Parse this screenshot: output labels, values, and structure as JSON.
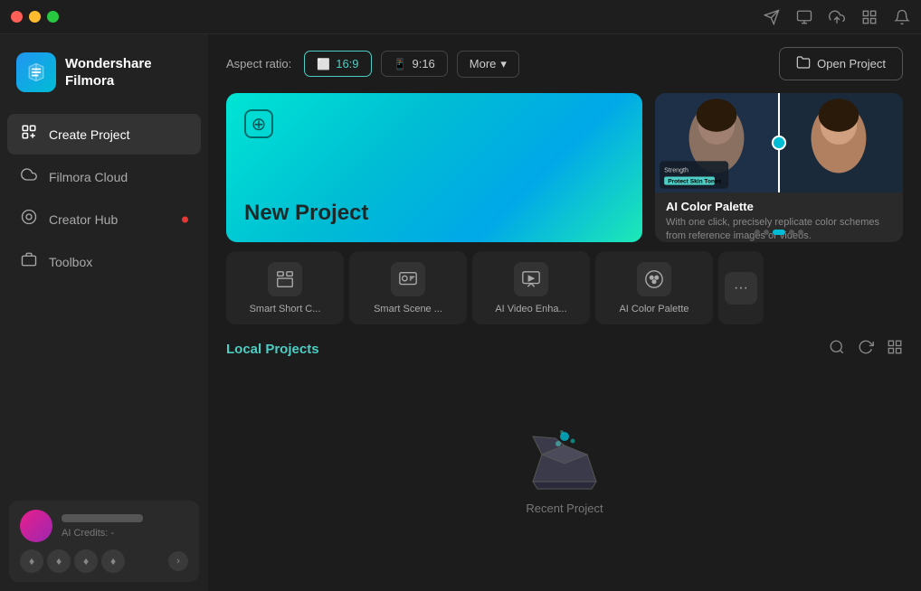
{
  "titlebar": {
    "app_name": "Wondershare Filmora"
  },
  "window_controls": {
    "close": "close",
    "minimize": "minimize",
    "maximize": "maximize"
  },
  "sidebar": {
    "logo_text": "Wondershare\nFilmora",
    "nav_items": [
      {
        "id": "create-project",
        "label": "Create Project",
        "icon": "⊞",
        "active": true,
        "dot": false
      },
      {
        "id": "filmora-cloud",
        "label": "Filmora Cloud",
        "icon": "☁",
        "active": false,
        "dot": false
      },
      {
        "id": "creator-hub",
        "label": "Creator Hub",
        "icon": "◎",
        "active": false,
        "dot": true
      },
      {
        "id": "toolbox",
        "label": "Toolbox",
        "icon": "⊡",
        "active": false,
        "dot": false
      }
    ],
    "user": {
      "name_placeholder": "",
      "credits_label": "AI Credits: -"
    }
  },
  "topbar": {
    "aspect_ratio_label": "Aspect ratio:",
    "aspect_options": [
      {
        "id": "16-9",
        "label": "16:9",
        "active": true
      },
      {
        "id": "9-16",
        "label": "9:16",
        "active": false
      }
    ],
    "more_label": "More",
    "open_project_label": "Open Project"
  },
  "new_project_card": {
    "label": "New Project"
  },
  "feature_card": {
    "title": "AI Color Palette",
    "description": "With one click, precisely replicate color schemes from reference images or videos.",
    "dots": [
      1,
      2,
      3,
      4,
      5
    ],
    "active_dot": 2,
    "overlay_title": "Strength",
    "overlay_tag": "Protect Skin Tones"
  },
  "tools": [
    {
      "id": "smart-short-c",
      "label": "Smart Short C...",
      "icon": "⊞"
    },
    {
      "id": "smart-scene",
      "label": "Smart Scene ...",
      "icon": "⊟"
    },
    {
      "id": "ai-video-enha",
      "label": "AI Video Enha...",
      "icon": "⊠"
    },
    {
      "id": "ai-color-palette",
      "label": "AI Color Palette",
      "icon": "◉"
    }
  ],
  "local_projects": {
    "title": "Local Projects",
    "empty_label": "Recent Project",
    "actions": {
      "search": "🔍",
      "refresh": "↻",
      "grid": "⊞"
    }
  }
}
